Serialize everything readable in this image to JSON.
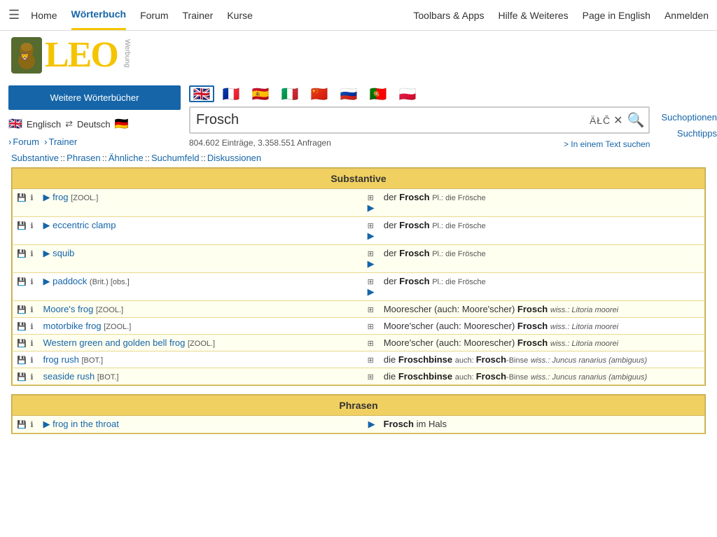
{
  "nav": {
    "hamburger": "☰",
    "links": [
      {
        "label": "Home",
        "active": false
      },
      {
        "label": "Wörterbuch",
        "active": true
      },
      {
        "label": "Forum",
        "active": false
      },
      {
        "label": "Trainer",
        "active": false
      },
      {
        "label": "Kurse",
        "active": false
      }
    ],
    "right_links": [
      {
        "label": "Toolbars & Apps"
      },
      {
        "label": "Hilfe & Weiteres"
      },
      {
        "label": "Page in English"
      },
      {
        "label": "Anmelden"
      }
    ]
  },
  "logo": {
    "text": "LEO",
    "werbung": "Werbung"
  },
  "sidebar": {
    "worterbuch_btn": "Weitere Wörterbücher",
    "lang_from": "Englisch",
    "lang_to": "Deutsch",
    "forum_link": "Forum",
    "trainer_link": "Trainer"
  },
  "flags": [
    "🇬🇧",
    "🇫🇷",
    "🇪🇸",
    "🇮🇹",
    "🇨🇳",
    "🇷🇺",
    "🇵🇹",
    "🇵🇱"
  ],
  "search": {
    "value": "Frosch",
    "atc_label": "ÄŁČ",
    "clear_icon": "✕",
    "search_icon": "🔍",
    "stats": "804.602 Einträge, 3.358.551 Anfragen",
    "text_search": "> In einem Text suchen",
    "suchoptionen": "Suchoptionen",
    "suchtipps": "Suchtipps"
  },
  "results": {
    "tabs": [
      {
        "label": "Substantive"
      },
      {
        "label": "Phrasen"
      },
      {
        "label": "Ähnliche"
      },
      {
        "label": "Suchumfeld"
      },
      {
        "label": "Diskussionen"
      }
    ],
    "substantive_header": "Substantive",
    "phrasen_header": "Phrasen",
    "rows_substantive": [
      {
        "en": "frog",
        "en_tag": "[ZOOL.]",
        "de": "der Frosch",
        "de_pl": "Pl.: die Frösche",
        "alt": true,
        "has_play": true
      },
      {
        "en": "eccentric clamp",
        "en_tag": "",
        "de": "der Frosch",
        "de_pl": "Pl.: die Frösche",
        "alt": false,
        "has_play": true
      },
      {
        "en": "squib",
        "en_tag": "",
        "de": "der Frosch",
        "de_pl": "Pl.: die Frösche",
        "alt": true,
        "has_play": true
      },
      {
        "en": "paddock",
        "en_tag": "(Brit.) [obs.]",
        "de": "der Frosch",
        "de_pl": "Pl.: die Frösche",
        "alt": false,
        "has_play": true
      },
      {
        "en": "Moore's frog",
        "en_tag": "[ZOOL.]",
        "de_full": "Moorescher (auch: Moore'scher) Frosch",
        "de_wiss": "wiss.: Litoria moorei",
        "alt": true,
        "has_play": false
      },
      {
        "en": "motorbike frog",
        "en_tag": "[ZOOL.]",
        "de_full": "Moore'scher (auch: Moorescher) Frosch",
        "de_wiss": "wiss.: Litoria moorei",
        "alt": false,
        "has_play": false
      },
      {
        "en": "Western green and golden bell frog",
        "en_tag": "[ZOOL.]",
        "de_full": "Moore'scher (auch: Moorescher) Frosch",
        "de_wiss": "wiss.: Litoria moorei",
        "alt": true,
        "has_play": false
      },
      {
        "en": "frog rush",
        "en_tag": "[BOT.]",
        "de_full": "die Froschbinse",
        "de_also": "auch: Frosch-Binse",
        "de_wiss": "wiss.: Juncus ranarius (ambiguus)",
        "alt": false,
        "has_play": false
      },
      {
        "en": "seaside rush",
        "en_tag": "[BOT.]",
        "de_full": "die Froschbinse",
        "de_also": "auch: Frosch-Binse",
        "de_wiss": "wiss.: Juncus ranarius (ambiguus)",
        "alt": true,
        "has_play": false
      }
    ],
    "rows_phrasen": [
      {
        "en": "frog in the throat",
        "de": "Frosch im Hals",
        "alt": true
      }
    ]
  }
}
